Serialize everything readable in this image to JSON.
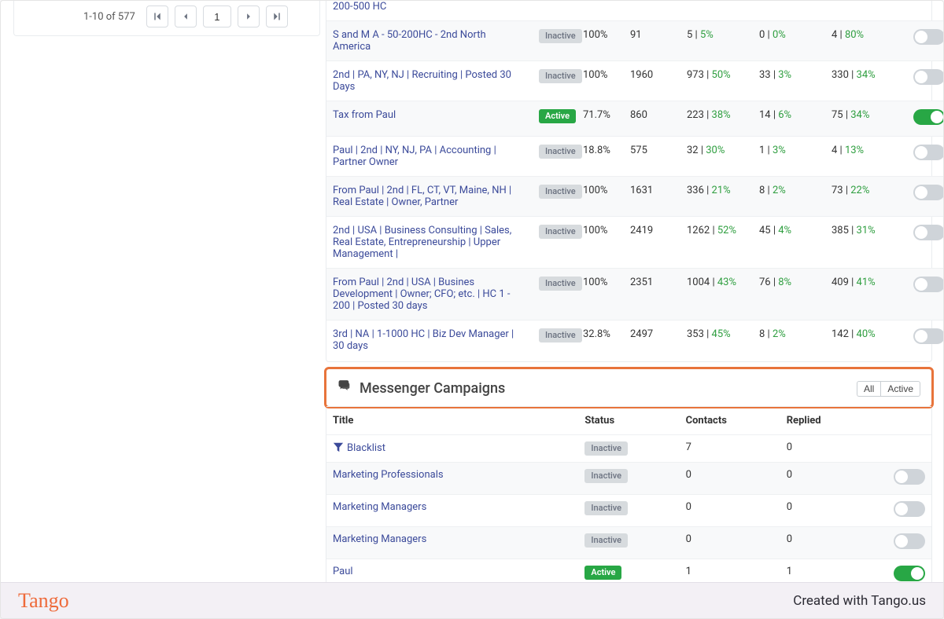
{
  "pager": {
    "range": "1-10 of 577",
    "page_value": "1"
  },
  "campaigns_partial_first": "200-500 HC",
  "campaigns": [
    {
      "title": "S and M A - 50-200HC - 2nd North America",
      "status": "Inactive",
      "pct": "100%",
      "contacts": "91",
      "s1v": "5",
      "s1p": "5%",
      "s2v": "0",
      "s2p": "0%",
      "s3v": "4",
      "s3p": "80%",
      "on": false
    },
    {
      "title": "2nd | PA, NY, NJ | Recruiting | Posted 30 Days",
      "status": "Inactive",
      "pct": "100%",
      "contacts": "1960",
      "s1v": "973",
      "s1p": "50%",
      "s2v": "33",
      "s2p": "3%",
      "s3v": "330",
      "s3p": "34%",
      "on": false
    },
    {
      "title": "Tax from Paul",
      "status": "Active",
      "pct": "71.7%",
      "contacts": "860",
      "s1v": "223",
      "s1p": "38%",
      "s2v": "14",
      "s2p": "6%",
      "s3v": "75",
      "s3p": "34%",
      "on": true
    },
    {
      "title": "Paul | 2nd | NY, NJ, PA | Accounting | Partner Owner",
      "status": "Inactive",
      "pct": "18.8%",
      "contacts": "575",
      "s1v": "32",
      "s1p": "30%",
      "s2v": "1",
      "s2p": "3%",
      "s3v": "4",
      "s3p": "13%",
      "on": false
    },
    {
      "title": "From Paul | 2nd | FL, CT, VT, Maine, NH | Real Estate | Owner, Partner",
      "status": "Inactive",
      "pct": "100%",
      "contacts": "1631",
      "s1v": "336",
      "s1p": "21%",
      "s2v": "8",
      "s2p": "2%",
      "s3v": "73",
      "s3p": "22%",
      "on": false
    },
    {
      "title": "2nd | USA | Business Consulting | Sales, Real Estate, Entrepreneurship | Upper Management |",
      "status": "Inactive",
      "pct": "100%",
      "contacts": "2419",
      "s1v": "1262",
      "s1p": "52%",
      "s2v": "45",
      "s2p": "4%",
      "s3v": "385",
      "s3p": "31%",
      "on": false
    },
    {
      "title": "From Paul | 2nd | USA | Busines Development | Owner; CFO; etc. | HC 1 - 200 | Posted 30 days",
      "status": "Inactive",
      "pct": "100%",
      "contacts": "2351",
      "s1v": "1004",
      "s1p": "43%",
      "s2v": "76",
      "s2p": "8%",
      "s3v": "409",
      "s3p": "41%",
      "on": false
    },
    {
      "title": "3rd | NA | 1-1000 HC | Biz Dev Manager | 30 days",
      "status": "Inactive",
      "pct": "32.8%",
      "contacts": "2497",
      "s1v": "353",
      "s1p": "45%",
      "s2v": "8",
      "s2p": "2%",
      "s3v": "142",
      "s3p": "40%",
      "on": false
    }
  ],
  "messenger": {
    "heading": "Messenger Campaigns",
    "filters": {
      "all": "All",
      "active": "Active"
    },
    "columns": {
      "title": "Title",
      "status": "Status",
      "contacts": "Contacts",
      "replied": "Replied"
    },
    "rows": [
      {
        "title": "Blacklist",
        "icon": "filter",
        "status": "Inactive",
        "contacts": "7",
        "replied": "0",
        "toggle": "none"
      },
      {
        "title": "Marketing Professionals",
        "status": "Inactive",
        "contacts": "0",
        "replied": "0",
        "toggle": "off"
      },
      {
        "title": "Marketing Managers",
        "status": "Inactive",
        "contacts": "0",
        "replied": "0",
        "toggle": "off"
      },
      {
        "title": "Marketing Managers",
        "status": "Inactive",
        "contacts": "0",
        "replied": "0",
        "toggle": "off"
      },
      {
        "title": "Paul",
        "status": "Active",
        "contacts": "1",
        "replied": "1",
        "toggle": "on"
      }
    ]
  },
  "footer": {
    "brand": "Tango",
    "credit": "Created with Tango.us"
  }
}
